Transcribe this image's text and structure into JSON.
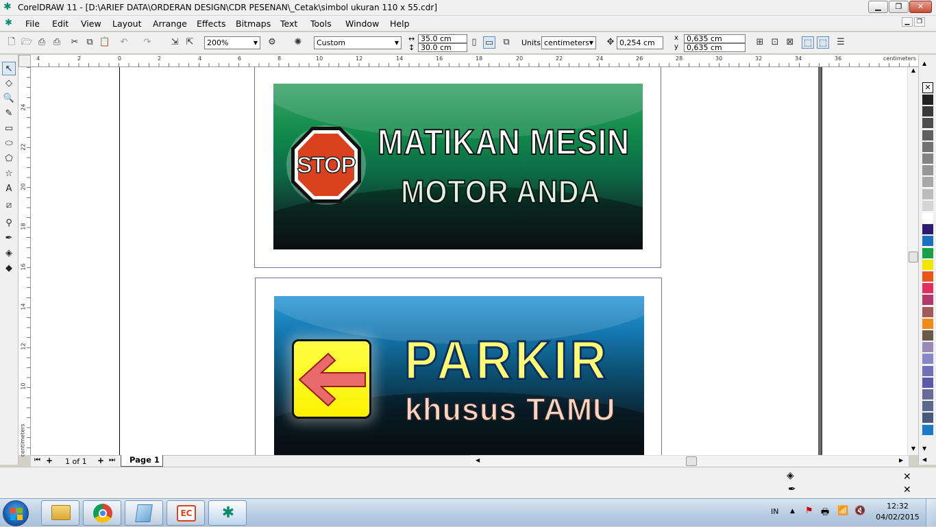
{
  "window": {
    "title": "CorelDRAW 11 - [D:\\ARIEF DATA\\ORDERAN DESIGN\\CDR PESENAN\\_Cetak\\simbol ukuran 110 x 55.cdr]",
    "controls": {
      "minimize": "▁",
      "restore": "❐",
      "close": "✕"
    }
  },
  "menu": {
    "items": [
      "File",
      "Edit",
      "View",
      "Layout",
      "Arrange",
      "Effects",
      "Bitmaps",
      "Text",
      "Tools",
      "Window",
      "Help"
    ]
  },
  "toolbar": {
    "zoom": "200%",
    "paper_type": "Custom",
    "page_width": "35.0 cm",
    "page_height": "30.0 cm",
    "units_label": "Units:",
    "units_value": "centimeters",
    "nudge": "0,254 cm",
    "dup_x": "0,635 cm",
    "dup_y": "0,635 cm",
    "dup_x_label": "x",
    "dup_y_label": "y"
  },
  "rulers": {
    "horizontal_labels": [
      "4",
      "2",
      "0",
      "2",
      "4",
      "6",
      "8",
      "10",
      "12",
      "14",
      "16",
      "18",
      "20",
      "22",
      "24",
      "26",
      "28",
      "30",
      "32",
      "34",
      "36"
    ],
    "horizontal_unit": "centimeters",
    "vertical_labels": [
      "24",
      "22",
      "20",
      "18",
      "16",
      "14",
      "12",
      "10"
    ],
    "vertical_unit": "centimeters"
  },
  "signs": {
    "sign1": {
      "stop": "STOP",
      "line1": "MATIKAN MESIN",
      "line2": "MOTOR ANDA"
    },
    "sign2": {
      "line1": "PARKIR",
      "line2": "khusus TAMU"
    }
  },
  "pagebar": {
    "page_count": "1 of 1",
    "page_tab": "Page 1"
  },
  "palette": {
    "colors": [
      "#222222",
      "#3a3a3a",
      "#4d4d4d",
      "#5f5f5f",
      "#717171",
      "#838383",
      "#969696",
      "#a8a8a8",
      "#bcbcbc",
      "#d4d4d4",
      "#ffffff",
      "#2e1a6e",
      "#1d6fbf",
      "#1a9e4a",
      "#f2e500",
      "#e8541a",
      "#e03060",
      "#b4386a",
      "#a05a5a",
      "#f08a1a",
      "#6a5a4a",
      "#9a8ab8",
      "#8888c8",
      "#7070b8",
      "#5a5aa8",
      "#6a6a9a",
      "#5a6a8a",
      "#4a5a7a",
      "#1a7ac8"
    ]
  },
  "taskbar": {
    "language": "IN",
    "time": "12:32",
    "date": "04/02/2015"
  }
}
